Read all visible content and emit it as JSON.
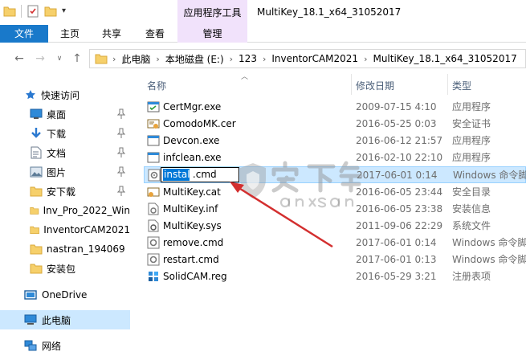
{
  "window": {
    "context_tab_group": "应用程序工具",
    "title": "MultiKey_18.1_x64_31052017"
  },
  "ribbon": {
    "tabs": [
      {
        "label": "文件"
      },
      {
        "label": "主页"
      },
      {
        "label": "共享"
      },
      {
        "label": "查看"
      },
      {
        "label": "管理"
      }
    ]
  },
  "address": {
    "crumbs": [
      "此电脑",
      "本地磁盘 (E:)",
      "123",
      "InventorCAM2021",
      "MultiKey_18.1_x64_31052017"
    ]
  },
  "sidebar": {
    "quick_access": "快速访问",
    "items": [
      {
        "label": "桌面",
        "icon": "desktop-icon",
        "pinned": true
      },
      {
        "label": "下载",
        "icon": "download-icon",
        "pinned": true
      },
      {
        "label": "文档",
        "icon": "documents-icon",
        "pinned": true
      },
      {
        "label": "图片",
        "icon": "pictures-icon",
        "pinned": true
      },
      {
        "label": "安下载",
        "icon": "folder-icon",
        "pinned": true
      },
      {
        "label": "Inv_Pro_2022_Win",
        "icon": "folder-icon",
        "pinned": false
      },
      {
        "label": "InventorCAM2021",
        "icon": "folder-icon",
        "pinned": false
      },
      {
        "label": "nastran_194069",
        "icon": "folder-icon",
        "pinned": false
      },
      {
        "label": "安装包",
        "icon": "folder-icon",
        "pinned": false
      }
    ],
    "onedrive": "OneDrive",
    "this_pc": "此电脑",
    "network": "网络"
  },
  "columns": {
    "name": "名称",
    "date": "修改日期",
    "type": "类型"
  },
  "files": [
    {
      "name": "CertMgr.exe",
      "date": "2009-07-15 4:10",
      "type": "应用程序",
      "icon": "exe-icon"
    },
    {
      "name": "ComodoMK.cer",
      "date": "2016-05-25 0:03",
      "type": "安全证书",
      "icon": "certificate-icon"
    },
    {
      "name": "Devcon.exe",
      "date": "2016-06-12 21:57",
      "type": "应用程序",
      "icon": "exe-icon"
    },
    {
      "name": "infclean.exe",
      "date": "2016-02-10 22:10",
      "type": "应用程序",
      "icon": "exe-icon"
    },
    {
      "name": "install.cmd",
      "date": "2017-06-01 0:14",
      "type": "Windows 命令脚本",
      "icon": "cmd-icon",
      "renaming": true,
      "rename_selected": "install",
      "rename_rest": ".cmd"
    },
    {
      "name": "MultiKey.cat",
      "date": "2016-06-05 23:44",
      "type": "安全目录",
      "icon": "catalog-icon"
    },
    {
      "name": "MultiKey.inf",
      "date": "2016-06-05 23:38",
      "type": "安装信息",
      "icon": "inf-icon"
    },
    {
      "name": "MultiKey.sys",
      "date": "2011-09-06 22:29",
      "type": "系统文件",
      "icon": "sys-icon"
    },
    {
      "name": "remove.cmd",
      "date": "2017-06-01 0:14",
      "type": "Windows 命令脚本",
      "icon": "cmd-icon"
    },
    {
      "name": "restart.cmd",
      "date": "2017-06-01 0:13",
      "type": "Windows 命令脚本",
      "icon": "cmd-icon"
    },
    {
      "name": "SolidCAM.reg",
      "date": "2016-05-29 3:21",
      "type": "注册表项",
      "icon": "reg-icon"
    }
  ],
  "colors": {
    "file_tab": "#1979ca",
    "context_tab": "#f1e2fb",
    "selection": "#cce8ff",
    "annotation_arrow": "#d32f2f"
  }
}
